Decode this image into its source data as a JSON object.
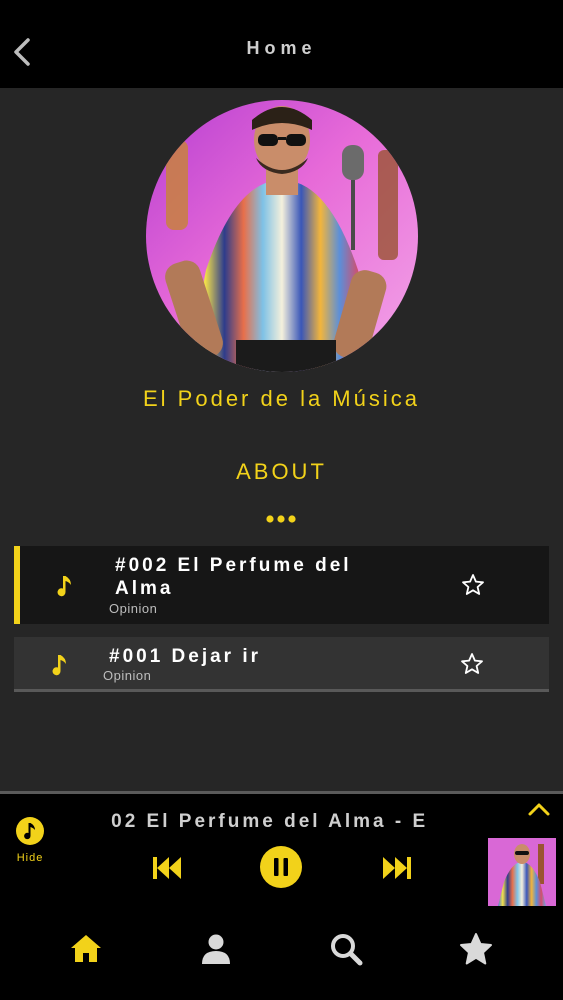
{
  "header": {
    "title": "Home",
    "back_icon": "chevron-left-icon"
  },
  "podcast": {
    "title": "El Poder de la Música",
    "about_label": "ABOUT",
    "more_icon": "more-dots-icon"
  },
  "episodes": [
    {
      "title": "#002 El Perfume del Alma",
      "subtitle": "Opinion",
      "active": true,
      "icon": "music-note-icon",
      "favorite_icon": "star-outline-icon"
    },
    {
      "title": "#001 Dejar ir",
      "subtitle": "Opinion",
      "active": false,
      "icon": "music-note-icon",
      "favorite_icon": "star-outline-icon"
    }
  ],
  "player": {
    "hide_label": "Hide",
    "now_playing": "#002 El Perfume del Alma - E",
    "controls": [
      "skip-back-icon",
      "pause-icon",
      "skip-forward-icon"
    ],
    "expand_icon": "chevron-up-icon"
  },
  "tabs": [
    {
      "name": "home",
      "icon": "home-icon",
      "active": true
    },
    {
      "name": "profile",
      "icon": "user-icon",
      "active": false
    },
    {
      "name": "search",
      "icon": "search-icon",
      "active": false
    },
    {
      "name": "favorites",
      "icon": "star-icon",
      "active": false
    }
  ],
  "colors": {
    "accent": "#f2d21a",
    "background": "#262626",
    "bar": "#000000",
    "active_row": "#161616",
    "inactive_row": "#333333"
  }
}
